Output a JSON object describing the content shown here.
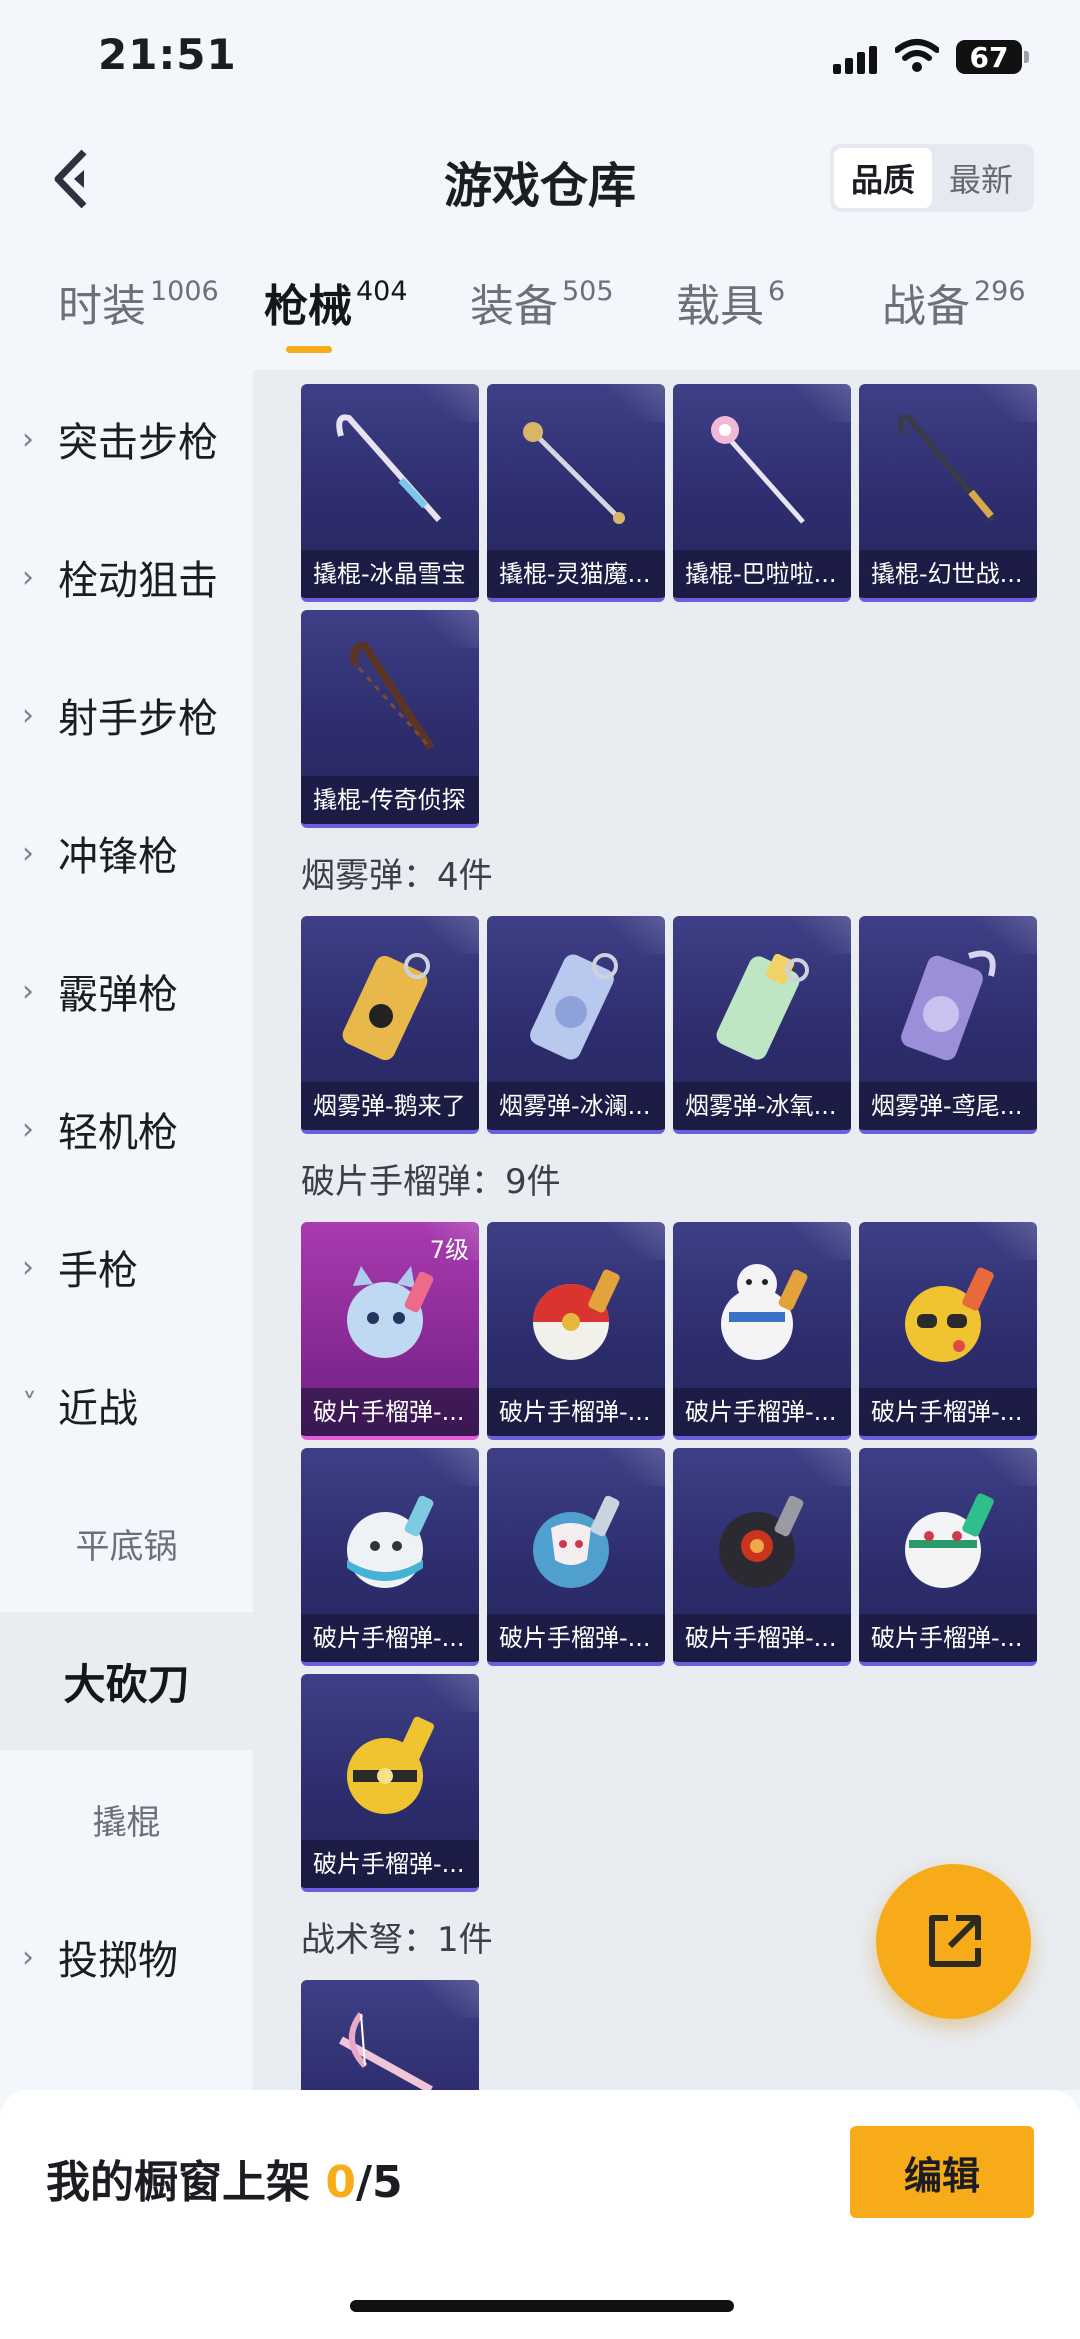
{
  "status_bar": {
    "time": "21:51",
    "battery": "67"
  },
  "header": {
    "title": "游戏仓库",
    "sort": [
      "品质",
      "最新"
    ]
  },
  "tabs": [
    {
      "label": "时装",
      "count": "1006"
    },
    {
      "label": "枪械",
      "count": "404"
    },
    {
      "label": "装备",
      "count": "505"
    },
    {
      "label": "载具",
      "count": "6"
    },
    {
      "label": "战备",
      "count": "296"
    }
  ],
  "sidebar": {
    "items": [
      {
        "label": "突击步枪",
        "chevron": ">"
      },
      {
        "label": "栓动狙击",
        "chevron": ">"
      },
      {
        "label": "射手步枪",
        "chevron": ">"
      },
      {
        "label": "冲锋枪",
        "chevron": ">"
      },
      {
        "label": "霰弹枪",
        "chevron": ">"
      },
      {
        "label": "轻机枪",
        "chevron": ">"
      },
      {
        "label": "手枪",
        "chevron": ">"
      },
      {
        "label": "近战",
        "chevron": "v"
      }
    ],
    "subitems": [
      "平底锅",
      "大砍刀",
      "撬棍"
    ],
    "last_item": {
      "label": "投掷物",
      "chevron": ">"
    }
  },
  "crowbars": [
    "撬棍-冰晶雪宝",
    "撬棍-灵猫魔...",
    "撬棍-巴啦啦...",
    "撬棍-幻世战...",
    "撬棍-传奇侦探"
  ],
  "smoke": {
    "header": "烟雾弹：4件",
    "items": [
      "烟雾弹-鹅来了",
      "烟雾弹-冰澜...",
      "烟雾弹-冰氧...",
      "烟雾弹-鸢尾..."
    ]
  },
  "grenade": {
    "header": "破片手榴弹：9件",
    "level": "7级",
    "items": [
      "破片手榴弹-...",
      "破片手榴弹-...",
      "破片手榴弹-...",
      "破片手榴弹-...",
      "破片手榴弹-...",
      "破片手榴弹-...",
      "破片手榴弹-...",
      "破片手榴弹-...",
      "破片手榴弹-..."
    ]
  },
  "crossbow": {
    "header": "战术弩：1件"
  },
  "bottom_bar": {
    "label": "我的橱窗上架",
    "current": "0",
    "total": "/5",
    "edit": "编辑"
  },
  "colors": {
    "accent": "#f8ab18",
    "card": "#2d2d6e",
    "card_rare": "#a83bb0"
  }
}
